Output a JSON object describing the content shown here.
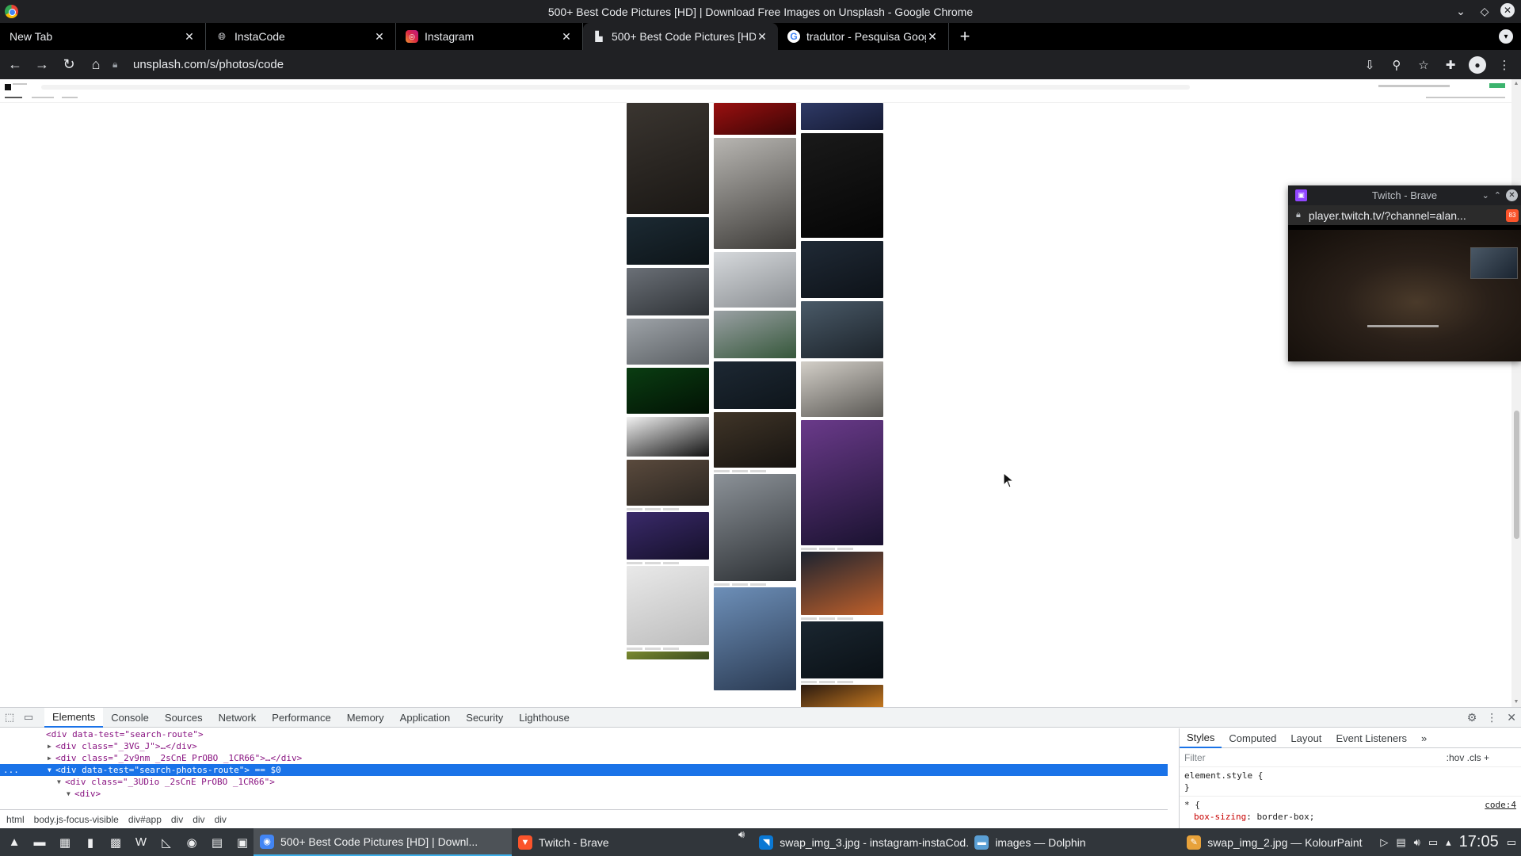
{
  "window": {
    "title": "500+ Best Code Pictures [HD] | Download Free Images on Unsplash - Google Chrome"
  },
  "tabs": [
    {
      "label": "New Tab",
      "icon": "",
      "active": false
    },
    {
      "label": "InstaCode",
      "icon": "globe-icon",
      "active": false
    },
    {
      "label": "Instagram",
      "icon": "instagram-icon",
      "active": false
    },
    {
      "label": "500+ Best Code Pictures [HD]",
      "icon": "unsplash-icon",
      "active": true
    },
    {
      "label": "tradutor - Pesquisa Google",
      "icon": "google-icon",
      "active": false
    }
  ],
  "address": {
    "url": "unsplash.com/s/photos/code"
  },
  "page": {
    "photos": [
      {
        "col": 0,
        "colors": [
          "#3a3530",
          "#1a1714"
        ]
      },
      {
        "col": 0,
        "colors": [
          "#1c2a33",
          "#0d1418"
        ]
      },
      {
        "col": 0,
        "colors": [
          "#6b7077",
          "#2e3236"
        ]
      },
      {
        "col": 0,
        "colors": [
          "#9ea3a8",
          "#5a5f63"
        ]
      },
      {
        "col": 0,
        "colors": [
          "#0a3d12",
          "#021204"
        ]
      },
      {
        "col": 0,
        "colors": [
          "#f2f2f2",
          "#111111"
        ]
      },
      {
        "col": 0,
        "colors": [
          "#5a4a3d",
          "#2a2520"
        ]
      },
      {
        "col": 0,
        "colors": [
          "#3a2a6a",
          "#15102a"
        ]
      },
      {
        "col": 0,
        "colors": [
          "#e9e9e9",
          "#bdbdbd"
        ]
      },
      {
        "col": 0,
        "colors": [
          "#7a8a30",
          "#3a4a20"
        ]
      },
      {
        "col": 1,
        "colors": [
          "#9a1010",
          "#3a0505"
        ]
      },
      {
        "col": 1,
        "colors": [
          "#b8b6b2",
          "#3d3b38"
        ]
      },
      {
        "col": 1,
        "colors": [
          "#d6d9dc",
          "#8a8e92"
        ]
      },
      {
        "col": 1,
        "colors": [
          "#9ba1a5",
          "#35573a"
        ]
      },
      {
        "col": 1,
        "colors": [
          "#1d2833",
          "#0e151b"
        ]
      },
      {
        "col": 1,
        "colors": [
          "#403528",
          "#161310"
        ]
      },
      {
        "col": 1,
        "colors": [
          "#8c9298",
          "#2c3034"
        ]
      },
      {
        "col": 1,
        "colors": [
          "#6d8fb8",
          "#2a3a52"
        ]
      },
      {
        "col": 2,
        "colors": [
          "#2f3a66",
          "#151a33"
        ]
      },
      {
        "col": 2,
        "colors": [
          "#1a1a1a",
          "#050505"
        ]
      },
      {
        "col": 2,
        "colors": [
          "#202a36",
          "#0d1218"
        ]
      },
      {
        "col": 2,
        "colors": [
          "#4a5a68",
          "#1b2229"
        ]
      },
      {
        "col": 2,
        "colors": [
          "#d3cfc8",
          "#5a5854"
        ]
      },
      {
        "col": 2,
        "colors": [
          "#6a3a8a",
          "#1a1230"
        ]
      },
      {
        "col": 2,
        "colors": [
          "#1c2330",
          "#c0602a"
        ]
      },
      {
        "col": 2,
        "colors": [
          "#1a2630",
          "#0a1015"
        ]
      },
      {
        "col": 2,
        "colors": [
          "#2a1a10",
          "#c87a20"
        ]
      }
    ]
  },
  "pip": {
    "title": "Twitch - Brave",
    "url": "player.twitch.tv/?channel=alan...",
    "badge": "83"
  },
  "devtools": {
    "tabs": [
      "Elements",
      "Console",
      "Sources",
      "Network",
      "Performance",
      "Memory",
      "Application",
      "Security",
      "Lighthouse"
    ],
    "active_tab": "Elements",
    "dom_lines": [
      {
        "indent": 4,
        "text": "<div data-test=\"search-route\">",
        "twisty": "",
        "selected": false
      },
      {
        "indent": 5,
        "text": "<div class=\"_3VG_J\">…</div>",
        "twisty": "▶",
        "selected": false
      },
      {
        "indent": 5,
        "text": "<div class=\"_2v9nm _2sCnE PrOBO _1CR66\">…</div>",
        "twisty": "▶",
        "selected": false
      },
      {
        "indent": 5,
        "text": "<div data-test=\"search-photos-route\"> == $0",
        "twisty": "▼",
        "selected": true
      },
      {
        "indent": 6,
        "text": "<div class=\"_3UDio _2sCnE PrOBO _1CR66\">",
        "twisty": "▼",
        "selected": false
      },
      {
        "indent": 7,
        "text": "<div>",
        "twisty": "▼",
        "selected": false
      }
    ],
    "row_marker": "...",
    "breadcrumbs": [
      "html",
      "body.js-focus-visible",
      "div#app",
      "div",
      "div",
      "div"
    ],
    "styles_tabs": [
      "Styles",
      "Computed",
      "Layout",
      "Event Listeners",
      "»"
    ],
    "filter_placeholder": "Filter",
    "hov_cls": ":hov  .cls  +",
    "element_style": "element.style {",
    "element_style_close": "}",
    "rule_selector": "* {",
    "rule_prop": "box-sizing",
    "rule_value": "border-box;",
    "rule_source": "code:4"
  },
  "taskbar": {
    "tasks": [
      {
        "label": "500+ Best Code Pictures [HD] | Downl...",
        "icon": "chrome-icon",
        "color": "#4285f4",
        "active": true,
        "width": 326
      },
      {
        "label": "Twitch - Brave",
        "icon": "brave-icon",
        "color": "#fb542b",
        "active": false,
        "width": 276
      },
      {
        "label": "swap_img_3.jpg - instagram-instaCod...",
        "icon": "vscode-icon",
        "color": "#0a78d4",
        "active": false,
        "width": 272
      },
      {
        "label": "images — Dolphin",
        "icon": "dolphin-icon",
        "color": "#5a9fd4",
        "active": false,
        "width": 268
      },
      {
        "label": "swap_img_2.jpg — KolourPaint",
        "icon": "kolourpaint-icon",
        "color": "#e8a23a",
        "active": false,
        "width": 270
      }
    ],
    "clock": "17:05"
  }
}
